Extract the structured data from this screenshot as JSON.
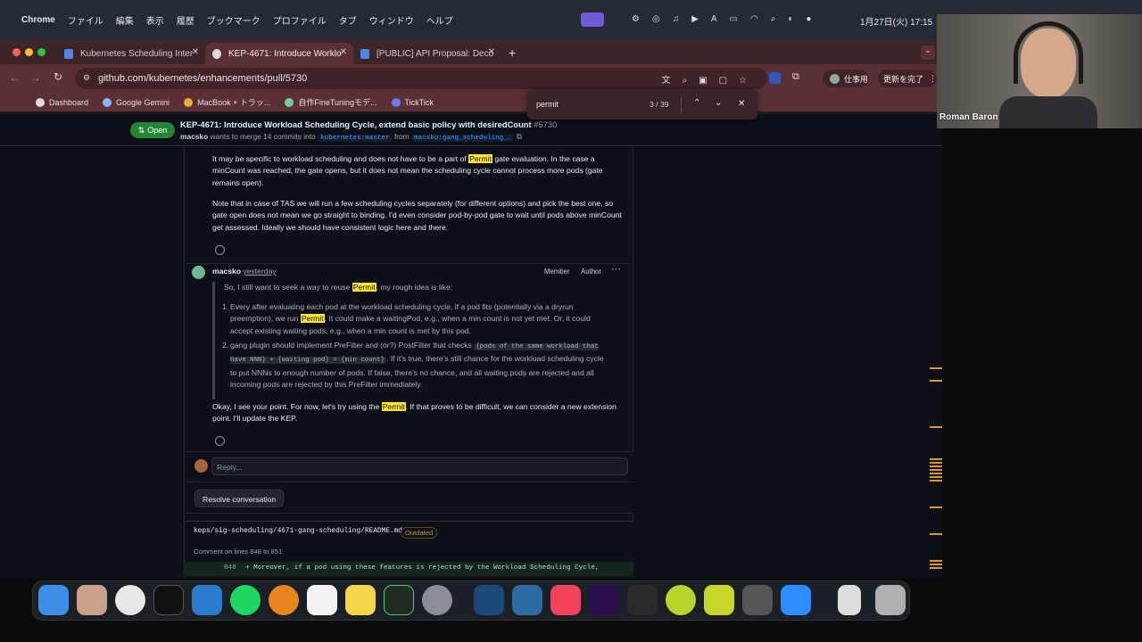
{
  "menubar": {
    "app": "Chrome",
    "items": [
      "ファイル",
      "編集",
      "表示",
      "履歴",
      "ブックマーク",
      "プロファイル",
      "タブ",
      "ウィンドウ",
      "ヘルプ"
    ],
    "clock": "1月27日(火) 17:15"
  },
  "tabs": [
    {
      "label": "Kubernetes Scheduling Inter"
    },
    {
      "label": "KEP-4671: Introduce Worklo"
    },
    {
      "label": "[PUBLIC] API Proposal: Deco"
    }
  ],
  "toolbar": {
    "url": "github.com/kubernetes/enhancements/pull/5730",
    "profile_label": "仕事用",
    "update_label": "更新を完了"
  },
  "bookmarks": [
    "Dashboard",
    "Google Gemini",
    "MacBook + トラッ...",
    "自作FineTuningモデ...",
    "TickTick"
  ],
  "find": {
    "query": "permit",
    "count": "3 / 39"
  },
  "pr": {
    "status": "Open",
    "title": "KEP-4671: Introduce Workload Scheduling Cycle, extend basic policy with desiredCount",
    "number": "#5730",
    "author": "macsko",
    "merge_text": "wants to merge 14 commits into",
    "base": "kubernetes:master",
    "from_word": "from",
    "head": "macsko:gang_scheduling_…"
  },
  "comment1": {
    "p1_a": "It may be specific to workload scheduling and does not have to be a part of ",
    "p1_hl": "Permit",
    "p1_b": " gate evaluation. In the case a minCount was reached, the gate opens, but it does not mean the scheduling cycle cannot process more pods (gate remains open).",
    "p2": "Note that in case of TAS we will run a few scheduling cycles separately (for different options) and pick the best one, so gate open does not mean we go straight to binding. I'd even consider pod-by-pod gate to wait until pods above minCount get assessed. Ideally we should have consistent logic here and there."
  },
  "comment2": {
    "author": "macsko",
    "time": "yesterday",
    "badge1": "Member",
    "badge2": "Author",
    "q_a": "So, I still want to seek a way to reuse ",
    "q_hl": "Permit",
    "q_b": ", my rough idea is like:",
    "li1_a": "Every after evaluating each pod at the workload scheduling cycle, if a pod fits (potentially via a dryrun preemption), we run ",
    "li1_hl": "Permit",
    "li1_b": ". It could make a waitingPod, e.g., when a min count is not yet met. Or, it could accept existing waiting pods, e.g., when a min count is met by this pod.",
    "li2_a": "gang plugin should implement PreFilter and (or?) PostFilter that checks ",
    "li2_code": "{pods of the same workload that have NNN} + {waiting pod} > {min count}",
    "li2_b": ". If it's true, there's still chance for the workload scheduling cycle to put NNNs to enough number of pods. If false, there's no chance, and all waiting pods are rejected and all incoming pods are rejected by this PreFilter immediately.",
    "reply_a": "Okay, I see your point. For now, let's try using the ",
    "reply_hl": "Permit",
    "reply_b": ". If that proves to be difficult, we can consider a new extension point. I'll update the KEP."
  },
  "reply": {
    "placeholder": "Reply..."
  },
  "resolve": {
    "label": "Resolve conversation"
  },
  "file": {
    "path": "keps/sig-scheduling/4671-gang-scheduling/README.md",
    "badge": "Outdated",
    "lines": "Comment on lines 848 to 851",
    "line_no": "848",
    "code": "+ Moreover, if a pod using these features is rejected by the Workload Scheduling Cycle,"
  },
  "participant": {
    "name": "Roman Baron"
  },
  "colors": {
    "page_bg": "#0d1117",
    "highlight": "#ffe62e",
    "open_badge": "#238636",
    "tabstrip": "#3d2427",
    "toolbar": "#5a3035"
  },
  "icons": [
    "apple-icon",
    "grid-icon",
    "search-icon",
    "wifi-icon",
    "chevron-up-icon",
    "chevron-down-icon",
    "close-icon",
    "star-icon",
    "smiley-icon",
    "kebab-icon"
  ]
}
